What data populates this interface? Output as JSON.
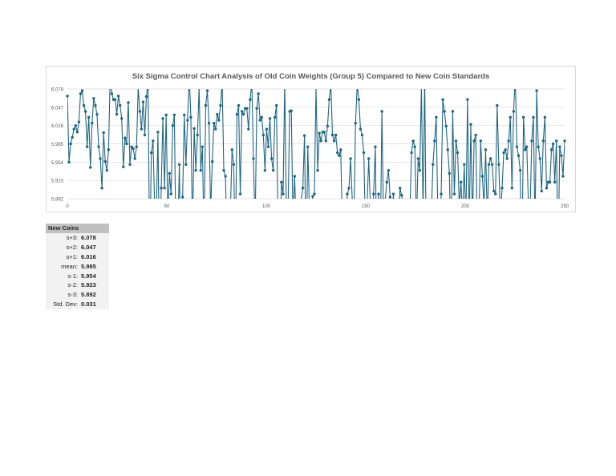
{
  "chart_data": {
    "type": "line",
    "title": "Six Sigma Control Chart Analysis of Old Coin Weights (Group 5) Compared to New Coin Standards",
    "xlim": [
      0,
      250
    ],
    "ylim": [
      5.892,
      6.078
    ],
    "x_ticks": [
      "0",
      "50",
      "100",
      "150",
      "200",
      "250"
    ],
    "y_ticks": [
      "6.078",
      "6.047",
      "6.016",
      "5.985",
      "5.954",
      "5.923",
      "5.892"
    ],
    "grid": true,
    "series_color": "#1f6683",
    "series": [
      {
        "values": [
          6.066,
          5.954,
          5.985,
          5.996,
          6.01,
          6.016,
          6.005,
          6.022,
          6.07,
          6.075,
          6.05,
          6.04,
          5.98,
          6.03,
          5.945,
          6.02,
          6.062,
          6.05,
          6.035,
          5.98,
          5.96,
          5.91,
          6.004,
          5.955,
          5.94,
          5.975,
          6.1,
          6.07,
          6.06,
          6.06,
          6.035,
          6.066,
          6.05,
          6.028,
          5.946,
          5.995,
          5.985,
          6.055,
          5.95,
          5.98,
          5.977,
          5.96,
          5.98,
          6.08,
          6.04,
          6.01,
          6.056,
          6.0,
          6.065,
          6.09,
          5.78,
          5.97,
          5.99,
          5.88,
          5.86,
          6.005,
          5.76,
          5.91,
          6.028,
          5.91,
          6.034,
          5.86,
          5.935,
          5.9,
          6.016,
          6.034,
          5.79,
          5.82,
          5.95,
          5.74,
          5.895,
          6.034,
          5.95,
          6.025,
          6.1,
          6.03,
          5.83,
          6.011,
          5.94,
          6.0,
          6.08,
          5.94,
          5.98,
          5.82,
          6.05,
          6.075,
          6.02,
          5.87,
          5.955,
          6.02,
          6.01,
          6.035,
          6.025,
          6.05,
          6.09,
          5.94,
          5.93,
          5.81,
          5.85,
          5.87,
          5.975,
          5.95,
          5.8,
          6.035,
          6.05,
          5.9,
          6.04,
          6.035,
          6.045,
          6.045,
          6.01,
          6.06,
          6.09,
          5.96,
          5.84,
          6.045,
          6.07,
          6.025,
          6.03,
          6.0,
          5.94,
          6.01,
          5.98,
          6.028,
          5.96,
          5.94,
          6.03,
          6.05,
          5.82,
          5.8,
          5.92,
          5.9,
          6.09,
          5.86,
          5.87,
          6.04,
          6.041,
          5.85,
          5.93,
          5.84,
          5.86,
          5.83,
          5.89,
          5.91,
          5.999,
          5.78,
          5.98,
          5.87,
          5.86,
          5.896,
          5.9,
          6.08,
          5.94,
          6.003,
          5.99,
          6.005,
          6.005,
          5.99,
          6.015,
          6.06,
          6.085,
          6.0,
          5.99,
          6.0,
          5.97,
          5.965,
          5.975,
          5.84,
          5.88,
          5.83,
          5.9,
          5.91,
          5.96,
          5.89,
          5.85,
          6.02,
          6.085,
          6.06,
          6.01,
          6.0,
          5.97,
          5.84,
          5.88,
          5.96,
          5.88,
          5.85,
          5.9,
          5.98,
          5.76,
          5.9,
          5.8,
          6.04,
          5.86,
          5.89,
          5.92,
          5.94,
          5.895,
          5.86,
          5.9,
          5.84,
          5.83,
          5.84,
          5.91,
          5.898,
          5.88,
          5.87,
          5.84,
          5.86,
          5.87,
          5.97,
          5.99,
          5.98,
          5.85,
          5.96,
          5.94,
          6.08,
          5.87,
          6.1,
          5.78,
          5.85,
          5.89,
          5.86,
          5.95,
          5.99,
          6.03,
          5.86,
          5.78,
          5.9,
          6.06,
          6.04,
          6.015,
          5.975,
          5.935,
          5.79,
          6.04,
          5.9,
          5.99,
          5.97,
          5.88,
          5.92,
          5.86,
          5.95,
          5.85,
          6.06,
          5.84,
          6.018,
          5.85,
          5.99,
          6.0,
          5.83,
          5.87,
          5.99,
          5.93,
          5.88,
          5.975,
          5.86,
          5.95,
          5.96,
          5.95,
          5.905,
          5.9,
          6.05,
          5.95,
          5.86,
          5.91,
          5.97,
          5.975,
          5.96,
          5.99,
          6.03,
          5.91,
          6.04,
          6.1,
          5.98,
          5.965,
          5.94,
          5.77,
          6.03,
          5.975,
          5.98,
          5.88,
          5.87,
          5.99,
          6.03,
          5.84,
          6.075,
          5.98,
          5.96,
          5.905,
          5.99,
          6.03,
          5.91,
          5.92,
          5.92,
          5.975,
          5.985,
          5.92,
          5.99,
          5.78,
          5.98,
          5.965,
          5.93,
          5.99
        ]
      }
    ]
  },
  "stats": {
    "header": "New Coins",
    "rows": [
      {
        "label": "s+3:",
        "value": "6.078"
      },
      {
        "label": "s+2:",
        "value": "6.047"
      },
      {
        "label": "s+1:",
        "value": "6.016"
      },
      {
        "label": "mean:",
        "value": "5.985"
      },
      {
        "label": "s-1:",
        "value": "5.954"
      },
      {
        "label": "s-2:",
        "value": "5.923"
      },
      {
        "label": "s-3:",
        "value": "5.892"
      },
      {
        "label": "Std. Dev:",
        "value": "0.031"
      }
    ]
  }
}
